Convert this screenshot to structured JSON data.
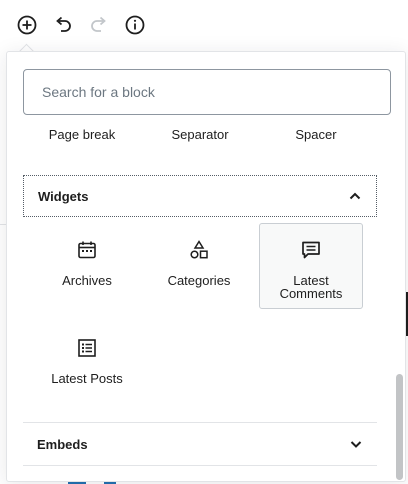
{
  "toolbar": {
    "add_block": "add-block-icon",
    "undo": "undo-icon",
    "redo": "redo-icon",
    "info": "info-icon"
  },
  "inserter": {
    "search": {
      "placeholder": "Search for a block",
      "value": ""
    },
    "layout_row": [
      "Page break",
      "Separator",
      "Spacer"
    ],
    "widgets": {
      "title": "Widgets",
      "expanded": true,
      "blocks": [
        {
          "label": "Archives",
          "icon": "archives-calendar-icon"
        },
        {
          "label": "Categories",
          "icon": "categories-shapes-icon"
        },
        {
          "label": "Latest Comments",
          "icon": "comment-icon",
          "highlighted": true
        },
        {
          "label": "Latest Posts",
          "icon": "list-icon"
        }
      ]
    },
    "embeds": {
      "title": "Embeds",
      "expanded": false
    }
  },
  "colors": {
    "border": "#e2e4e7",
    "text": "#1e1e1e",
    "placeholder": "#6c7781",
    "accent": "#2271b1"
  }
}
